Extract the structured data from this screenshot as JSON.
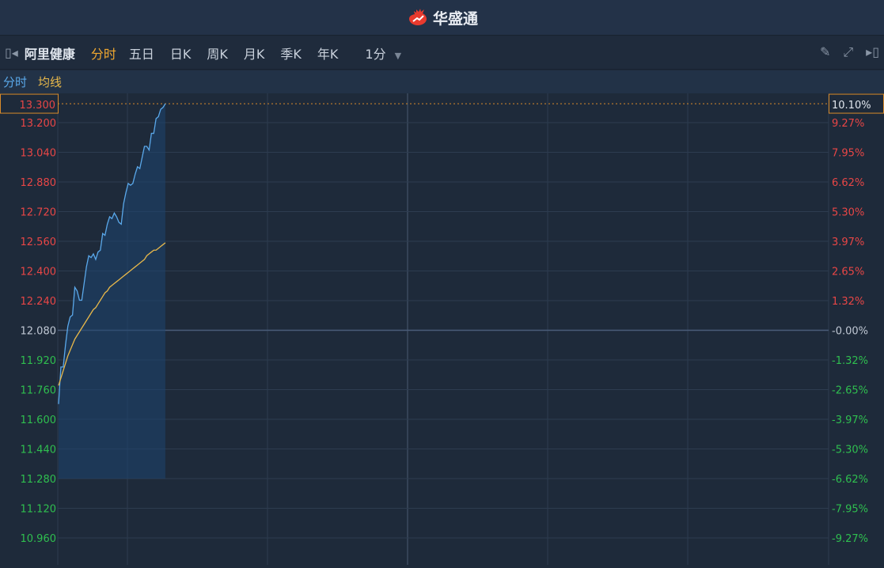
{
  "app": {
    "title": "华盛通"
  },
  "toolbar": {
    "stock_name": "阿里健康",
    "tabs": [
      "分时",
      "五日",
      "日K",
      "周K",
      "月K",
      "季K",
      "年K"
    ],
    "active_tab": "分时",
    "interval": "1分"
  },
  "legend": {
    "price_label": "分时",
    "avg_label": "均线"
  },
  "colors": {
    "up": "#e84646",
    "down": "#2fbf4f",
    "price_line": "#5aa8ea",
    "avg_line": "#e8b84a",
    "highlight": "#d88a2a"
  },
  "chart_data": {
    "type": "line",
    "prev_close": 12.08,
    "ylim": [
      10.8,
      13.3
    ],
    "left_ticks": [
      "13.200",
      "13.040",
      "12.880",
      "12.720",
      "12.560",
      "12.400",
      "12.240",
      "12.080",
      "11.920",
      "11.760",
      "11.600",
      "11.440",
      "11.280",
      "11.120",
      "10.960"
    ],
    "right_ticks": [
      "9.27%",
      "7.95%",
      "6.62%",
      "5.30%",
      "3.97%",
      "2.65%",
      "1.32%",
      "-0.00%",
      "-1.32%",
      "-2.65%",
      "-3.97%",
      "-5.30%",
      "-6.62%",
      "-7.95%",
      "-9.27%"
    ],
    "current_price_label": "13.300",
    "current_pct_label": "10.10%",
    "minutes_total": 330,
    "series": [
      {
        "name": "分时",
        "values": [
          11.68,
          11.88,
          11.88,
          12.0,
          12.1,
          12.15,
          12.16,
          12.31,
          12.29,
          12.24,
          12.24,
          12.33,
          12.42,
          12.48,
          12.47,
          12.49,
          12.46,
          12.5,
          12.51,
          12.6,
          12.59,
          12.65,
          12.69,
          12.68,
          12.71,
          12.69,
          12.66,
          12.65,
          12.76,
          12.82,
          12.87,
          12.86,
          12.87,
          12.92,
          12.96,
          12.95,
          13.01,
          13.07,
          13.07,
          13.05,
          13.14,
          13.14,
          13.22,
          13.23,
          13.27,
          13.28,
          13.3
        ]
      },
      {
        "name": "均线",
        "values": [
          11.78,
          11.82,
          11.86,
          11.9,
          11.94,
          11.97,
          12.0,
          12.03,
          12.05,
          12.07,
          12.09,
          12.11,
          12.13,
          12.15,
          12.17,
          12.19,
          12.2,
          12.22,
          12.24,
          12.26,
          12.28,
          12.29,
          12.31,
          12.32,
          12.33,
          12.34,
          12.35,
          12.36,
          12.37,
          12.38,
          12.39,
          12.4,
          12.41,
          12.42,
          12.43,
          12.44,
          12.45,
          12.46,
          12.48,
          12.49,
          12.5,
          12.51,
          12.51,
          12.52,
          12.53,
          12.54,
          12.55
        ]
      }
    ]
  }
}
